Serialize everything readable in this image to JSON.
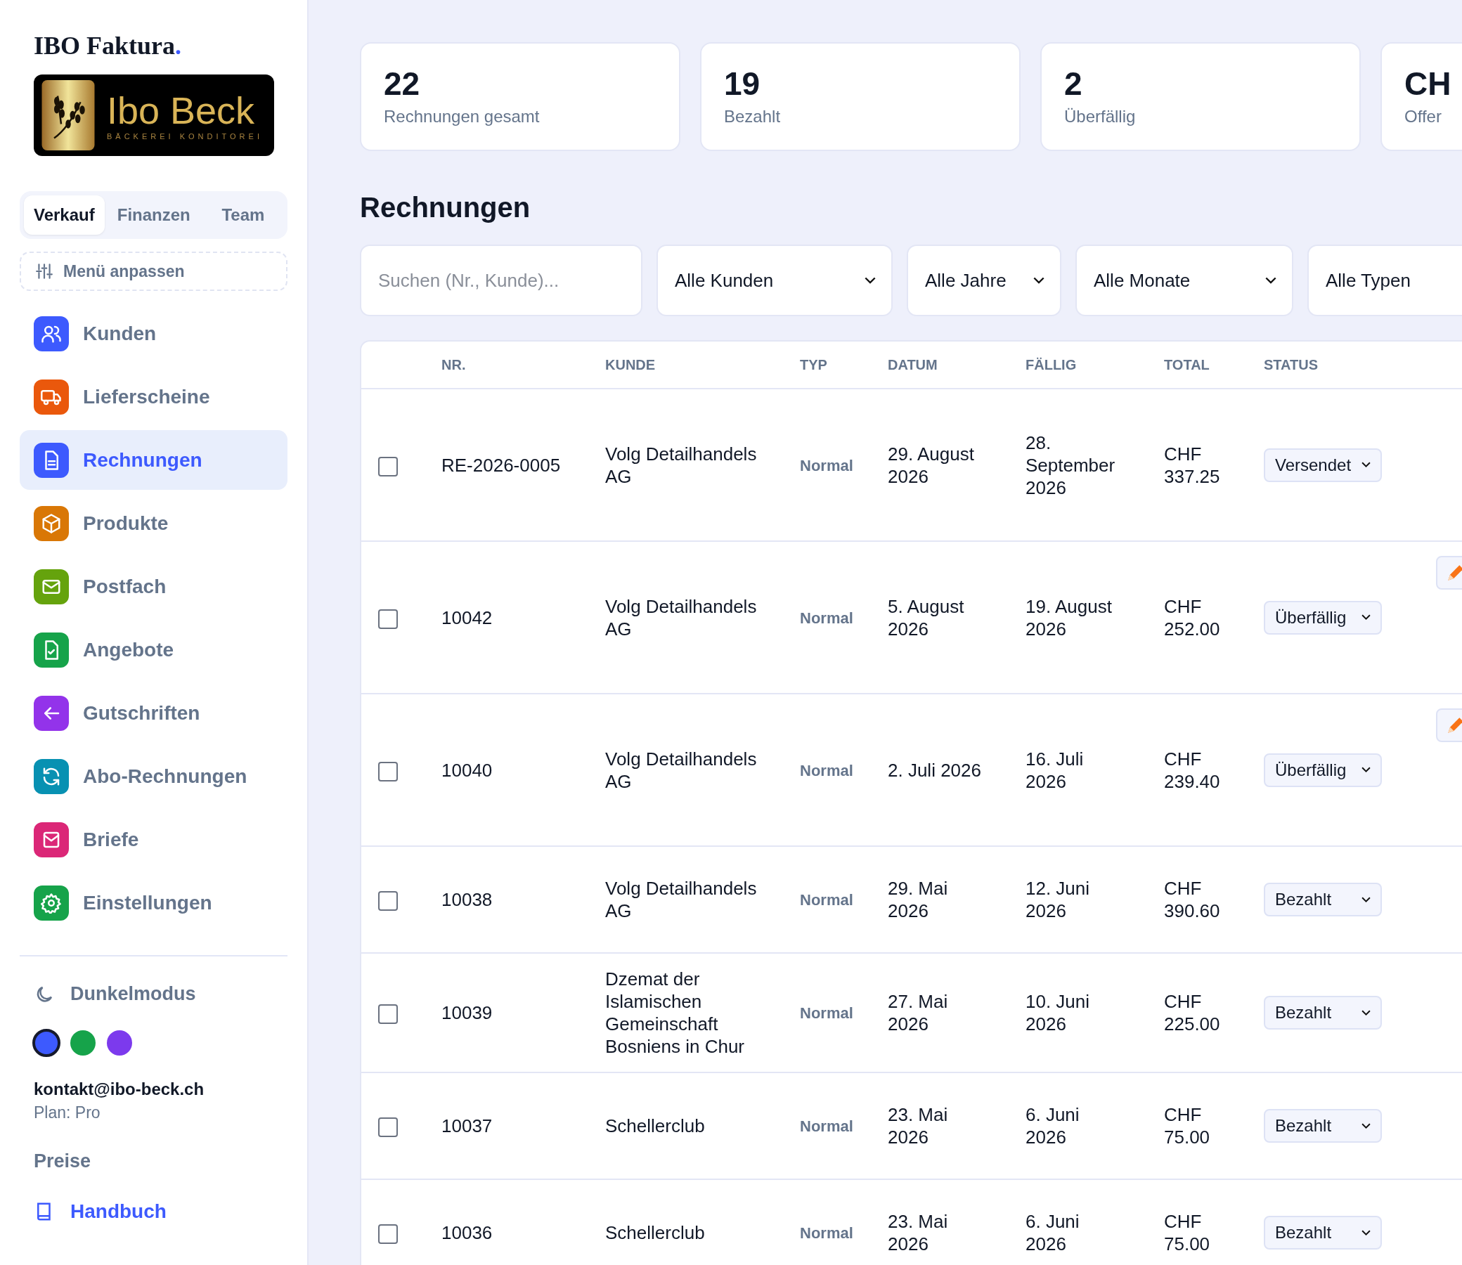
{
  "brand": {
    "name": "IBO Faktura",
    "mark": "."
  },
  "logo": {
    "name": "Ibo Beck",
    "tagline": "BÄCKEREI KONDITOREI"
  },
  "section_tabs": [
    {
      "label": "Verkauf",
      "selected": true
    },
    {
      "label": "Finanzen",
      "selected": false
    },
    {
      "label": "Team",
      "selected": false
    }
  ],
  "customize_button": "Menü anpassen",
  "nav": [
    {
      "label": "Kunden",
      "kind": "users",
      "color": "#3d5afe",
      "selected": false
    },
    {
      "label": "Lieferscheine",
      "kind": "truck",
      "color": "#ea580c",
      "selected": false
    },
    {
      "label": "Rechnungen",
      "kind": "document",
      "color": "#3d5afe",
      "selected": true
    },
    {
      "label": "Produkte",
      "kind": "box",
      "color": "#d97706",
      "selected": false
    },
    {
      "label": "Postfach",
      "kind": "mail",
      "color": "#65a30d",
      "selected": false
    },
    {
      "label": "Angebote",
      "kind": "doccheck",
      "color": "#16a34a",
      "selected": false
    },
    {
      "label": "Gutschriften",
      "kind": "arrow",
      "color": "#9333ea",
      "selected": false
    },
    {
      "label": "Abo-Rechnungen",
      "kind": "refresh",
      "color": "#0891b2",
      "selected": false
    },
    {
      "label": "Briefe",
      "kind": "letter",
      "color": "#db2777",
      "selected": false
    },
    {
      "label": "Einstellungen",
      "kind": "gear",
      "color": "#16a34a",
      "selected": false
    }
  ],
  "dark_mode": {
    "label": "Dunkelmodus"
  },
  "themes": [
    {
      "color": "#3d5afe",
      "selected": true
    },
    {
      "color": "#16a34a",
      "selected": false
    },
    {
      "color": "#7c3aed",
      "selected": false
    }
  ],
  "account": {
    "email": "kontakt@ibo-beck.ch",
    "plan": "Plan: Pro"
  },
  "links": [
    {
      "label": "Preise",
      "kind": "plain"
    },
    {
      "label": "Handbuch",
      "kind": "book"
    }
  ],
  "stats": [
    {
      "value": "22",
      "label": "Rechnungen gesamt"
    },
    {
      "value": "19",
      "label": "Bezahlt"
    },
    {
      "value": "2",
      "label": "Überfällig"
    },
    {
      "value": "CH",
      "label": "Offer"
    }
  ],
  "heading": "Rechnungen",
  "filters": {
    "search": {
      "placeholder": "Suchen (Nr., Kunde)..."
    },
    "selects": [
      {
        "value": "Alle Kunden",
        "caret": true
      },
      {
        "value": "Alle Jahre",
        "caret": true
      },
      {
        "value": "Alle Monate",
        "caret": true
      },
      {
        "value": "Alle Typen",
        "caret": false
      }
    ]
  },
  "table": {
    "columns": [
      "NR.",
      "KUNDE",
      "TYP",
      "DATUM",
      "FÄLLIG",
      "TOTAL",
      "STATUS"
    ],
    "rows": [
      {
        "checked": false,
        "number": "RE-2026-0005",
        "customer": "Volg Detailhandels AG",
        "type": "Normal",
        "date": "29. August 2026",
        "due": "28. September 2026",
        "total": "CHF 337.25",
        "status": "Versendet",
        "edit_button": false
      },
      {
        "checked": false,
        "number": "10042",
        "customer": "Volg Detailhandels AG",
        "type": "Normal",
        "date": "5. August 2026",
        "due": "19. August 2026",
        "total": "CHF 252.00",
        "status": "Überfällig",
        "edit_button": true
      },
      {
        "checked": false,
        "number": "10040",
        "customer": "Volg Detailhandels AG",
        "type": "Normal",
        "date": "2. Juli 2026",
        "due": "16. Juli 2026",
        "total": "CHF 239.40",
        "status": "Überfällig",
        "edit_button": true
      },
      {
        "checked": false,
        "number": "10038",
        "customer": "Volg Detailhandels AG",
        "type": "Normal",
        "date": "29. Mai 2026",
        "due": "12. Juni 2026",
        "total": "CHF 390.60",
        "status": "Bezahlt",
        "edit_button": false
      },
      {
        "checked": false,
        "number": "10039",
        "customer": "Dzemat der Islamischen Gemeinschaft Bosniens in Chur",
        "type": "Normal",
        "date": "27. Mai 2026",
        "due": "10. Juni 2026",
        "total": "CHF 225.00",
        "status": "Bezahlt",
        "edit_button": false
      },
      {
        "checked": false,
        "number": "10037",
        "customer": "Schellerclub",
        "type": "Normal",
        "date": "23. Mai 2026",
        "due": "6. Juni 2026",
        "total": "CHF 75.00",
        "status": "Bezahlt",
        "edit_button": false
      },
      {
        "checked": false,
        "number": "10036",
        "customer": "Schellerclub",
        "type": "Normal",
        "date": "23. Mai 2026",
        "due": "6. Juni 2026",
        "total": "CHF 75.00",
        "status": "Bezahlt",
        "edit_button": false
      }
    ]
  }
}
